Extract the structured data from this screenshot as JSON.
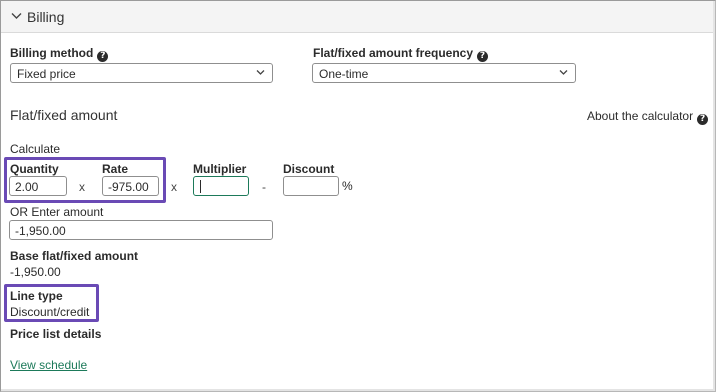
{
  "section": {
    "title": "Billing"
  },
  "billing_method": {
    "label": "Billing method",
    "value": "Fixed price"
  },
  "frequency": {
    "label": "Flat/fixed amount frequency",
    "value": "One-time"
  },
  "flat": {
    "heading": "Flat/fixed amount",
    "about": "About the calculator",
    "calculate": "Calculate",
    "quantity_label": "Quantity",
    "quantity_value": "2.00",
    "rate_label": "Rate",
    "rate_value": "-975.00",
    "multiplier_label": "Multiplier",
    "multiplier_value": "",
    "discount_label": "Discount",
    "discount_value": "",
    "op_x1": "x",
    "op_x2": "x",
    "op_minus": "-",
    "percent": "%",
    "or_enter": "OR Enter amount",
    "amount_value": "-1,950.00",
    "base_label": "Base flat/fixed amount",
    "base_value": "-1,950.00",
    "line_type_label": "Line type",
    "line_type_value": "Discount/credit",
    "price_list_label": "Price list details",
    "view_schedule": "View schedule"
  },
  "colors": {
    "highlight": "#6a4ab5",
    "link": "#1d7a5a",
    "focus": "#1d7a5a"
  }
}
